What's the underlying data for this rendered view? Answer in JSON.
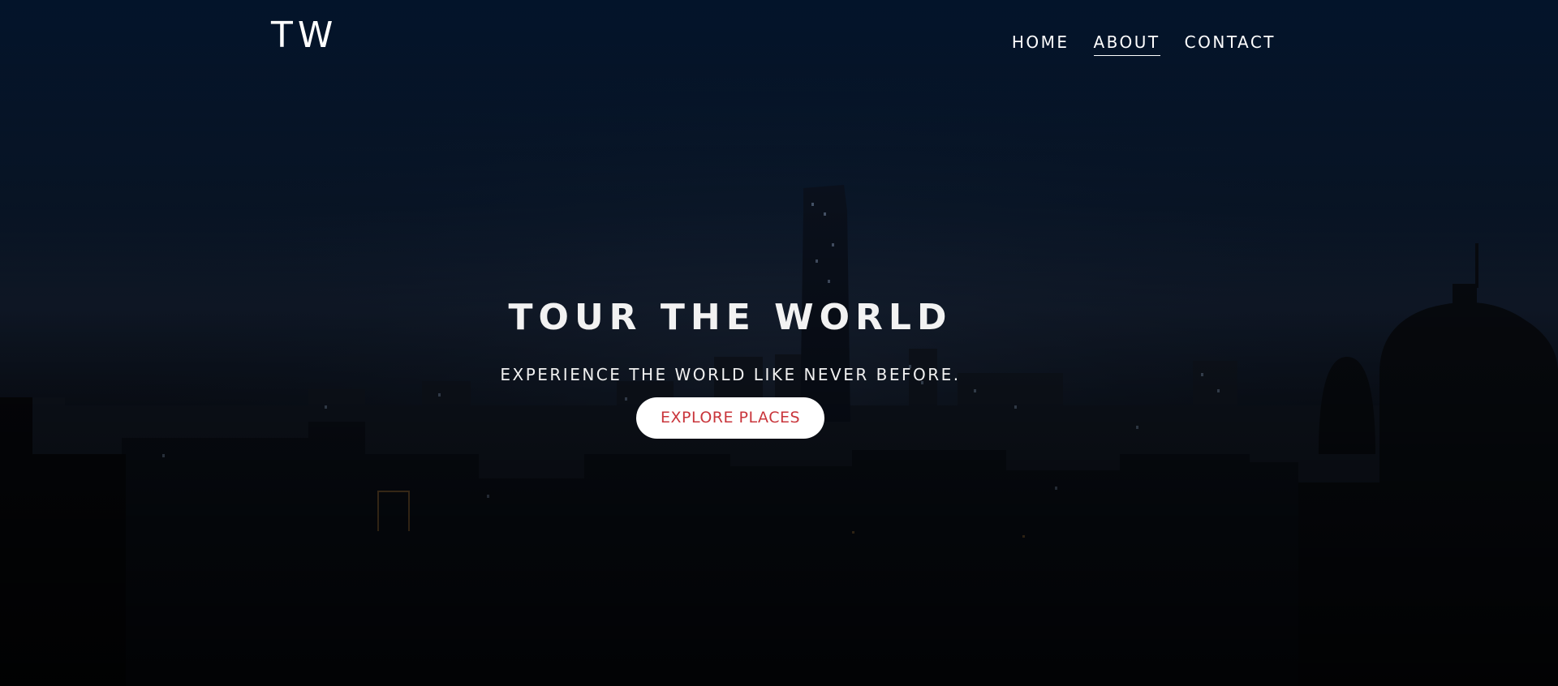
{
  "brand": {
    "logo_text": "TW"
  },
  "nav": {
    "items": [
      {
        "label": "HOME",
        "active": false
      },
      {
        "label": "ABOUT",
        "active": true
      },
      {
        "label": "CONTACT",
        "active": false
      }
    ]
  },
  "hero": {
    "title": "TOUR THE WORLD",
    "subtitle": "EXPERIENCE THE WORLD LIKE NEVER BEFORE.",
    "cta_label": "EXPLORE PLACES",
    "background": "night-city-skyline-image"
  },
  "colors": {
    "cta_text": "#c9353b",
    "cta_background": "#ffffff",
    "nav_text": "#ffffff",
    "sky_top": "#03142a",
    "sky_bottom": "#040507"
  }
}
